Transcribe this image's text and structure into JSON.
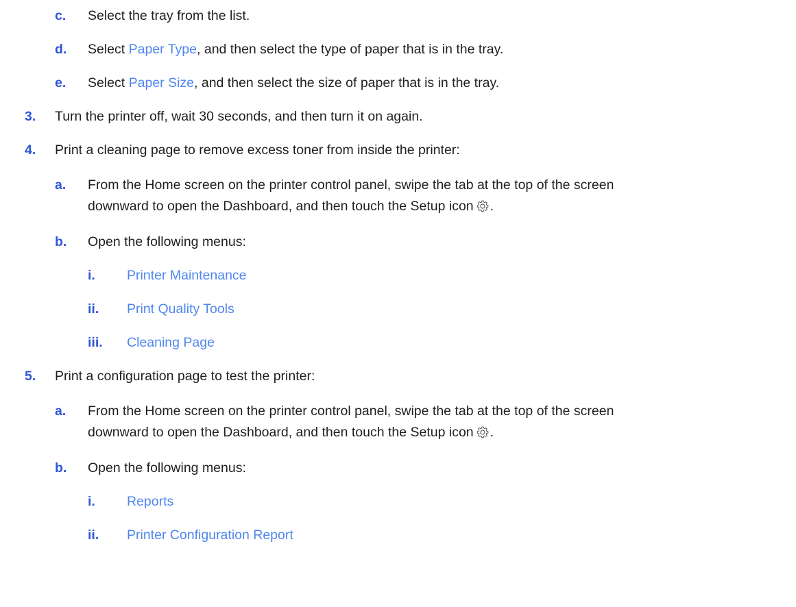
{
  "colors": {
    "marker": "#2f56d6",
    "link": "#4f86f0",
    "text": "#1f1f1f"
  },
  "steps": {
    "step2": {
      "c": {
        "marker": "c.",
        "text": "Select the tray from the list."
      },
      "d": {
        "marker": "d.",
        "pre": "Select ",
        "link": "Paper Type",
        "post": ", and then select the type of paper that is in the tray."
      },
      "e": {
        "marker": "e.",
        "pre": "Select ",
        "link": "Paper Size",
        "post": ", and then select the size of paper that is in the tray."
      }
    },
    "step3": {
      "marker": "3.",
      "text": "Turn the printer off, wait 30 seconds, and then turn it on again."
    },
    "step4": {
      "marker": "4.",
      "text": "Print a cleaning page to remove excess toner from inside the printer:",
      "a": {
        "marker": "a.",
        "line1": "From the Home screen on the printer control panel, swipe the tab at the top of the screen",
        "line2": "downward to open the Dashboard, and then touch the Setup icon",
        "icon": "gear-icon",
        "end": "."
      },
      "b": {
        "marker": "b.",
        "text": "Open the following menus:",
        "menus": [
          {
            "marker": "i.",
            "label": "Printer Maintenance"
          },
          {
            "marker": "ii.",
            "label": "Print Quality Tools"
          },
          {
            "marker": "iii.",
            "label": "Cleaning Page"
          }
        ]
      }
    },
    "step5": {
      "marker": "5.",
      "text": "Print a configuration page to test the printer:",
      "a": {
        "marker": "a.",
        "line1": "From the Home screen on the printer control panel, swipe the tab at the top of the screen",
        "line2": "downward to open the Dashboard, and then touch the Setup icon",
        "icon": "gear-icon",
        "end": "."
      },
      "b": {
        "marker": "b.",
        "text": "Open the following menus:",
        "menus": [
          {
            "marker": "i.",
            "label": "Reports"
          },
          {
            "marker": "ii.",
            "label": "Printer Configuration Report"
          }
        ]
      }
    }
  }
}
